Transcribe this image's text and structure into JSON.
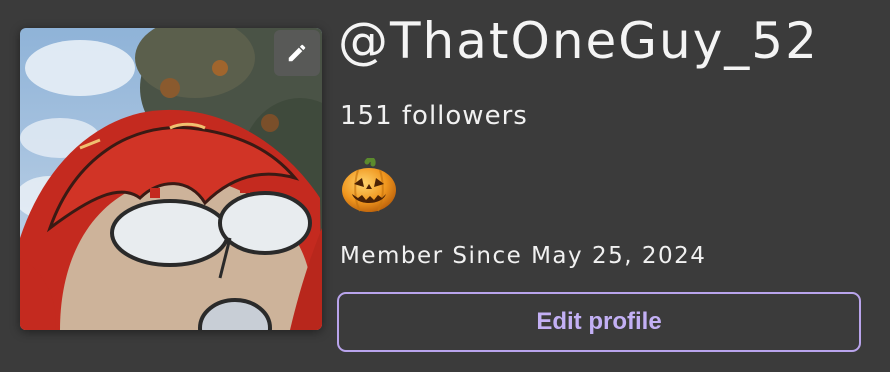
{
  "profile": {
    "username": "@ThatOneGuy_52",
    "followers": "151 followers",
    "member_since": "Member Since May 25, 2024",
    "badge_icon": "jack-o-lantern-icon",
    "avatar": {
      "edit_icon": "pencil-icon",
      "description_icon": "avatar-image"
    },
    "edit_button_label": "Edit profile"
  },
  "colors": {
    "background": "#3b3b3b",
    "accent": "#c3b0f5",
    "text": "#f2f2f2"
  }
}
